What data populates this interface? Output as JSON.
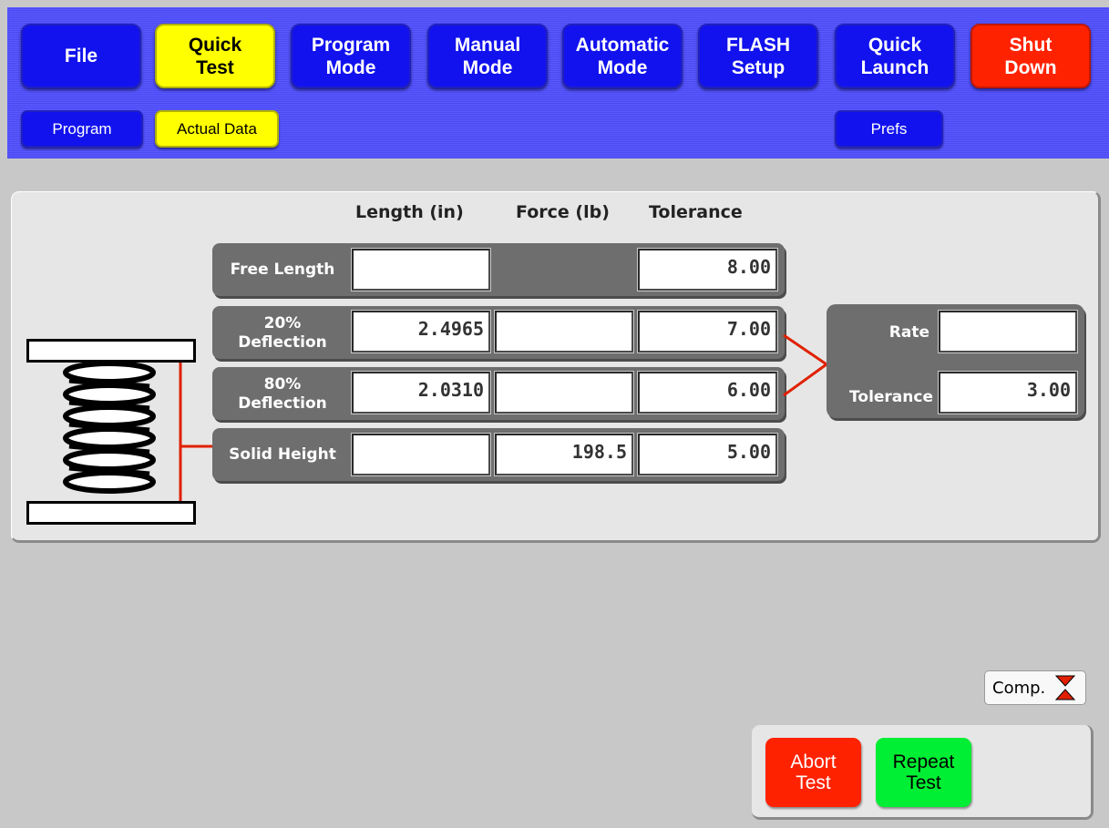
{
  "nav": [
    {
      "label": "File",
      "state": "normal"
    },
    {
      "label": "Quick\nTest",
      "state": "active"
    },
    {
      "label": "Program\nMode",
      "state": "normal"
    },
    {
      "label": "Manual\nMode",
      "state": "normal"
    },
    {
      "label": "Automatic\nMode",
      "state": "normal"
    },
    {
      "label": "FLASH\nSetup",
      "state": "normal"
    },
    {
      "label": "Quick\nLaunch",
      "state": "normal"
    },
    {
      "label": "Shut\nDown",
      "state": "danger"
    }
  ],
  "subnav": {
    "program": "Program",
    "actual_data": "Actual Data",
    "prefs": "Prefs"
  },
  "columns": {
    "length": "Length (in)",
    "force": "Force (lb)",
    "tolerance": "Tolerance"
  },
  "rows": [
    {
      "label": "Free Length",
      "length": "",
      "force": null,
      "tolerance": "8.00"
    },
    {
      "label": "20%\nDeflection",
      "length": "2.4965",
      "force": "",
      "tolerance": "7.00"
    },
    {
      "label": "80%\nDeflection",
      "length": "2.0310",
      "force": "",
      "tolerance": "6.00"
    },
    {
      "label": "Solid Height",
      "length": "",
      "force": "198.5",
      "tolerance": "5.00"
    }
  ],
  "rate": {
    "rate_label": "Rate",
    "rate_value": "",
    "tolerance_label": "Tolerance",
    "tolerance_value": "3.00"
  },
  "comp_button": "Comp.",
  "actions": {
    "abort": "Abort\nTest",
    "repeat": "Repeat\nTest"
  },
  "colors": {
    "header": "#4a4af0",
    "nav_button": "#1212ee",
    "active": "#ffff00",
    "danger": "#ff2200",
    "go": "#00ee33",
    "connector": "#e02000"
  }
}
